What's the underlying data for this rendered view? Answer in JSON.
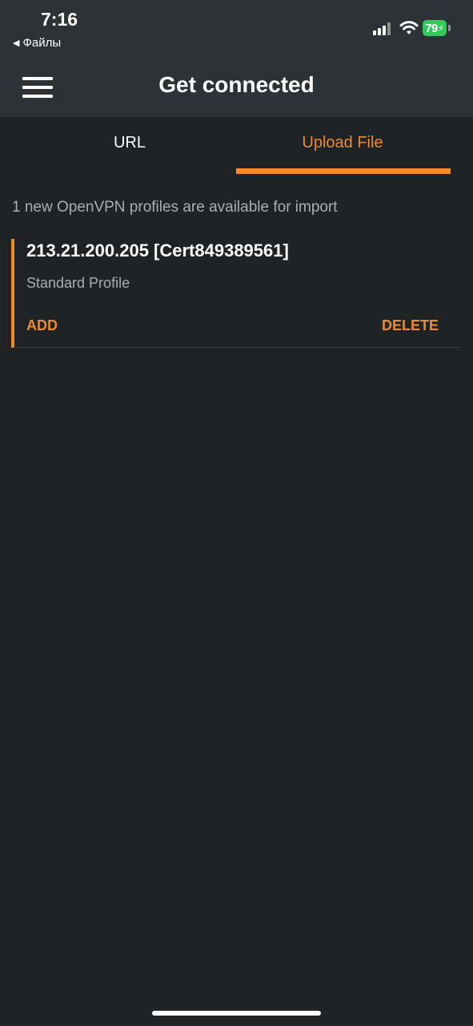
{
  "status_bar": {
    "time": "7:16",
    "back_app": "Файлы",
    "battery": "79",
    "battery_color": "#34c759",
    "icons": [
      "signal-icon",
      "wifi-icon",
      "battery-icon"
    ]
  },
  "app_bar": {
    "title": "Get connected",
    "menu_icon": "hamburger-menu-icon"
  },
  "tabs": [
    {
      "label": "URL",
      "selected": false
    },
    {
      "label": "Upload File",
      "selected": true
    }
  ],
  "accent_color": "#f08a2c",
  "info_text": "1 new OpenVPN profiles are available for import",
  "profiles": [
    {
      "name": "213.21.200.205 [Cert849389561]",
      "type": "Standard Profile",
      "add_label": "ADD",
      "delete_label": "DELETE"
    }
  ]
}
